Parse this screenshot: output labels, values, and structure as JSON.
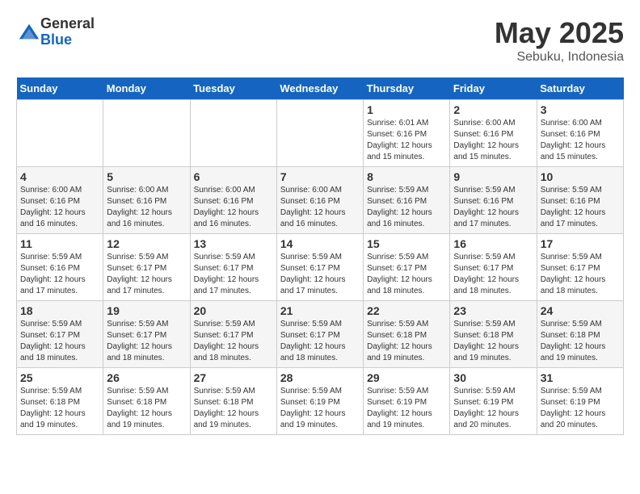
{
  "header": {
    "logo": {
      "general": "General",
      "blue": "Blue"
    },
    "month": "May 2025",
    "location": "Sebuku, Indonesia"
  },
  "weekdays": [
    "Sunday",
    "Monday",
    "Tuesday",
    "Wednesday",
    "Thursday",
    "Friday",
    "Saturday"
  ],
  "weeks": [
    [
      {
        "day": "",
        "info": ""
      },
      {
        "day": "",
        "info": ""
      },
      {
        "day": "",
        "info": ""
      },
      {
        "day": "",
        "info": ""
      },
      {
        "day": "1",
        "info": "Sunrise: 6:01 AM\nSunset: 6:16 PM\nDaylight: 12 hours\nand 15 minutes."
      },
      {
        "day": "2",
        "info": "Sunrise: 6:00 AM\nSunset: 6:16 PM\nDaylight: 12 hours\nand 15 minutes."
      },
      {
        "day": "3",
        "info": "Sunrise: 6:00 AM\nSunset: 6:16 PM\nDaylight: 12 hours\nand 15 minutes."
      }
    ],
    [
      {
        "day": "4",
        "info": "Sunrise: 6:00 AM\nSunset: 6:16 PM\nDaylight: 12 hours\nand 16 minutes."
      },
      {
        "day": "5",
        "info": "Sunrise: 6:00 AM\nSunset: 6:16 PM\nDaylight: 12 hours\nand 16 minutes."
      },
      {
        "day": "6",
        "info": "Sunrise: 6:00 AM\nSunset: 6:16 PM\nDaylight: 12 hours\nand 16 minutes."
      },
      {
        "day": "7",
        "info": "Sunrise: 6:00 AM\nSunset: 6:16 PM\nDaylight: 12 hours\nand 16 minutes."
      },
      {
        "day": "8",
        "info": "Sunrise: 5:59 AM\nSunset: 6:16 PM\nDaylight: 12 hours\nand 16 minutes."
      },
      {
        "day": "9",
        "info": "Sunrise: 5:59 AM\nSunset: 6:16 PM\nDaylight: 12 hours\nand 17 minutes."
      },
      {
        "day": "10",
        "info": "Sunrise: 5:59 AM\nSunset: 6:16 PM\nDaylight: 12 hours\nand 17 minutes."
      }
    ],
    [
      {
        "day": "11",
        "info": "Sunrise: 5:59 AM\nSunset: 6:16 PM\nDaylight: 12 hours\nand 17 minutes."
      },
      {
        "day": "12",
        "info": "Sunrise: 5:59 AM\nSunset: 6:17 PM\nDaylight: 12 hours\nand 17 minutes."
      },
      {
        "day": "13",
        "info": "Sunrise: 5:59 AM\nSunset: 6:17 PM\nDaylight: 12 hours\nand 17 minutes."
      },
      {
        "day": "14",
        "info": "Sunrise: 5:59 AM\nSunset: 6:17 PM\nDaylight: 12 hours\nand 17 minutes."
      },
      {
        "day": "15",
        "info": "Sunrise: 5:59 AM\nSunset: 6:17 PM\nDaylight: 12 hours\nand 18 minutes."
      },
      {
        "day": "16",
        "info": "Sunrise: 5:59 AM\nSunset: 6:17 PM\nDaylight: 12 hours\nand 18 minutes."
      },
      {
        "day": "17",
        "info": "Sunrise: 5:59 AM\nSunset: 6:17 PM\nDaylight: 12 hours\nand 18 minutes."
      }
    ],
    [
      {
        "day": "18",
        "info": "Sunrise: 5:59 AM\nSunset: 6:17 PM\nDaylight: 12 hours\nand 18 minutes."
      },
      {
        "day": "19",
        "info": "Sunrise: 5:59 AM\nSunset: 6:17 PM\nDaylight: 12 hours\nand 18 minutes."
      },
      {
        "day": "20",
        "info": "Sunrise: 5:59 AM\nSunset: 6:17 PM\nDaylight: 12 hours\nand 18 minutes."
      },
      {
        "day": "21",
        "info": "Sunrise: 5:59 AM\nSunset: 6:17 PM\nDaylight: 12 hours\nand 18 minutes."
      },
      {
        "day": "22",
        "info": "Sunrise: 5:59 AM\nSunset: 6:18 PM\nDaylight: 12 hours\nand 19 minutes."
      },
      {
        "day": "23",
        "info": "Sunrise: 5:59 AM\nSunset: 6:18 PM\nDaylight: 12 hours\nand 19 minutes."
      },
      {
        "day": "24",
        "info": "Sunrise: 5:59 AM\nSunset: 6:18 PM\nDaylight: 12 hours\nand 19 minutes."
      }
    ],
    [
      {
        "day": "25",
        "info": "Sunrise: 5:59 AM\nSunset: 6:18 PM\nDaylight: 12 hours\nand 19 minutes."
      },
      {
        "day": "26",
        "info": "Sunrise: 5:59 AM\nSunset: 6:18 PM\nDaylight: 12 hours\nand 19 minutes."
      },
      {
        "day": "27",
        "info": "Sunrise: 5:59 AM\nSunset: 6:18 PM\nDaylight: 12 hours\nand 19 minutes."
      },
      {
        "day": "28",
        "info": "Sunrise: 5:59 AM\nSunset: 6:19 PM\nDaylight: 12 hours\nand 19 minutes."
      },
      {
        "day": "29",
        "info": "Sunrise: 5:59 AM\nSunset: 6:19 PM\nDaylight: 12 hours\nand 19 minutes."
      },
      {
        "day": "30",
        "info": "Sunrise: 5:59 AM\nSunset: 6:19 PM\nDaylight: 12 hours\nand 20 minutes."
      },
      {
        "day": "31",
        "info": "Sunrise: 5:59 AM\nSunset: 6:19 PM\nDaylight: 12 hours\nand 20 minutes."
      }
    ]
  ]
}
